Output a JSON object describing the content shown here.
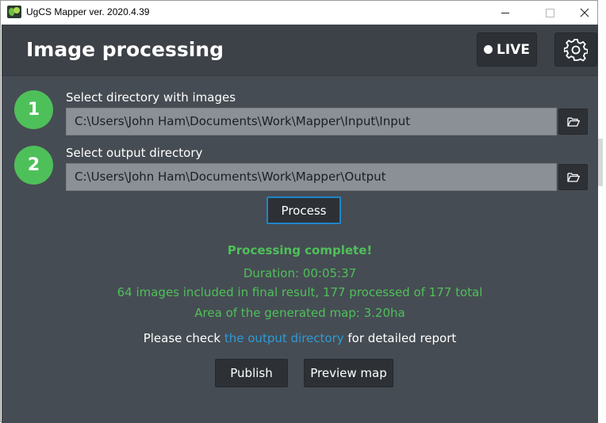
{
  "window": {
    "title": "UgCS Mapper ver. 2020.4.39",
    "controls": {
      "minimize": "—",
      "maximize": "☐",
      "close": "✕"
    }
  },
  "header": {
    "title": "Image processing",
    "live_label": "LIVE",
    "settings_icon": "gear-icon"
  },
  "steps": [
    {
      "number": "1",
      "label": "Select directory with images",
      "path": "C:\\Users\\John Ham\\Documents\\Work\\Mapper\\Input\\Input",
      "browse_icon": "folder-open-icon"
    },
    {
      "number": "2",
      "label": "Select output directory",
      "path": "C:\\Users\\John Ham\\Documents\\Work\\Mapper\\Output",
      "browse_icon": "folder-open-icon"
    }
  ],
  "process_label": "Process",
  "result": {
    "title": "Processing complete!",
    "duration": "Duration: 00:05:37",
    "images": "64 images included in final result, 177 processed of 177 total",
    "area": "Area of the generated map: 3.20ha"
  },
  "report": {
    "prefix": "Please check",
    "link": "the output directory",
    "suffix": "for detailed report"
  },
  "actions": {
    "publish": "Publish",
    "preview": "Preview map"
  },
  "colors": {
    "accent_green": "#4ec05a",
    "link_blue": "#2d9bd8",
    "focus_border": "#1e86c8",
    "background": "#464c53"
  }
}
